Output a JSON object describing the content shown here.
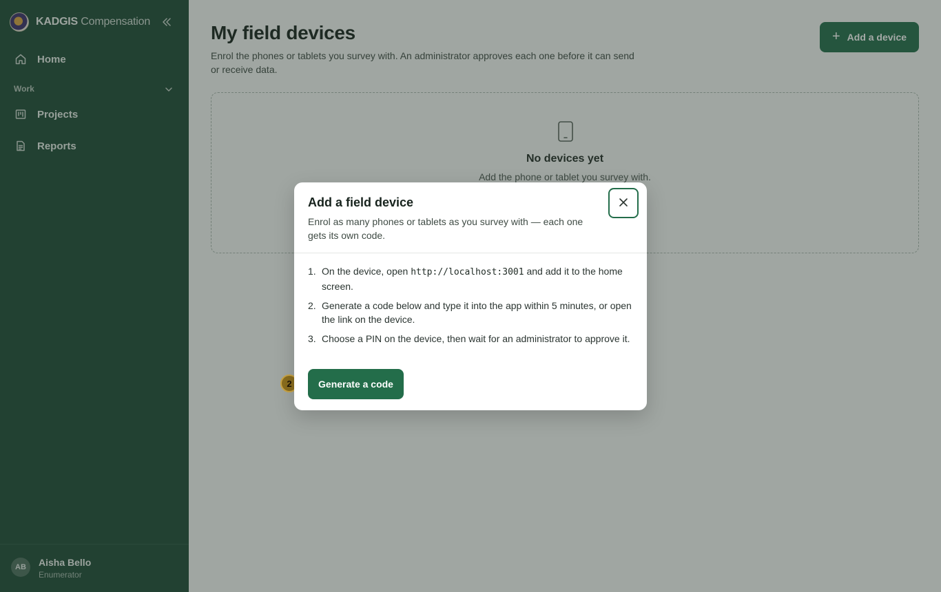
{
  "app": {
    "brand_bold": "KADGIS",
    "brand_rest": "Compensation",
    "logo_icon": "seal-logo-icon",
    "collapse_icon": "chevrons-left-icon"
  },
  "sidebar": {
    "items": [
      {
        "label": "Home",
        "icon": "home-icon"
      },
      {
        "label": "Projects",
        "icon": "projects-icon"
      },
      {
        "label": "Reports",
        "icon": "document-icon"
      }
    ],
    "section_label": "Work",
    "user": {
      "initials": "AB",
      "name": "Aisha Bello",
      "role": "Enumerator"
    }
  },
  "main": {
    "title": "My field devices",
    "description": "Enrol the phones or tablets you survey with. An administrator approves each one before it can send or receive data.",
    "add_button": "Add a device",
    "empty": {
      "title": "No devices yet",
      "subtitle": "Add the phone or tablet you survey with."
    }
  },
  "modal": {
    "title": "Add a field device",
    "subtitle": "Enrol as many phones or tablets as you survey with — each one gets its own code.",
    "steps": [
      {
        "num": "1.",
        "before": "On the device, open ",
        "code": "http://localhost:3001",
        "after": " and add it to the home screen."
      },
      {
        "num": "2.",
        "text": "Generate a code below and type it into the app within 5 minutes, or open the link on the device."
      },
      {
        "num": "3.",
        "text": "Choose a PIN on the device, then wait for an administrator to approve it."
      }
    ],
    "generate_button": "Generate a code"
  },
  "overlay_marker": {
    "label": "2"
  },
  "colors": {
    "sidebar_bg": "#1e4a36",
    "accent": "#236d4a",
    "page_bg": "#f7f8f6",
    "marker": "#8a6d1e"
  }
}
